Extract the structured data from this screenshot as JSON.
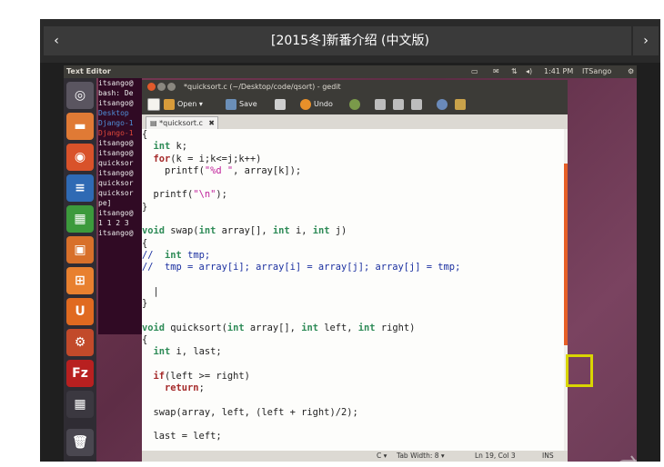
{
  "header": {
    "title": "[2015冬]新番介绍 (中文版)",
    "prev_label": "‹",
    "next_label": "›"
  },
  "ubuntu_panel": {
    "app_name": "Text Editor",
    "time": "1:41 PM",
    "user": "ITSango"
  },
  "terminal_lines": [
    "itsango@",
    "bash: De",
    "itsango@",
    "Desktop",
    "Django-1",
    "Django-1",
    "itsango@",
    "itsango@",
    "quicksor",
    "itsango@",
    "quicksor",
    "quicksor",
    "pe]",
    "itsango@",
    "1 1 2 3",
    "itsango@"
  ],
  "gedit": {
    "window_title": "*quicksort.c (~/Desktop/code/qsort) - gedit",
    "toolbar": {
      "open_label": "Open",
      "save_label": "Save",
      "undo_label": "Undo"
    },
    "tab_label": "*quicksort.c",
    "status": {
      "language": "C ▾",
      "tab_width": "Tab Width: 8 ▾",
      "position": "Ln 19, Col 3",
      "mode": "INS"
    }
  },
  "code_lines": [
    {
      "indent": "",
      "parts": [
        [
          "",
          "{"
        ]
      ]
    },
    {
      "indent": "  ",
      "parts": [
        [
          "ty",
          "int"
        ],
        [
          "",
          " k;"
        ]
      ]
    },
    {
      "indent": "  ",
      "parts": [
        [
          "kw",
          "for"
        ],
        [
          "",
          "(k = i;k<=j;k++)"
        ]
      ]
    },
    {
      "indent": "    ",
      "parts": [
        [
          "",
          "printf("
        ],
        [
          "st",
          "\"%d \""
        ],
        [
          "",
          ", array[k]);"
        ]
      ]
    },
    {
      "indent": "",
      "parts": [
        [
          "",
          ""
        ]
      ]
    },
    {
      "indent": "  ",
      "parts": [
        [
          "",
          "printf("
        ],
        [
          "st",
          "\"\\n\""
        ],
        [
          "",
          ");"
        ]
      ]
    },
    {
      "indent": "",
      "parts": [
        [
          "",
          "}"
        ]
      ]
    },
    {
      "indent": "",
      "parts": [
        [
          "",
          ""
        ]
      ]
    },
    {
      "indent": "",
      "parts": [
        [
          "ty",
          "void"
        ],
        [
          "",
          " swap("
        ],
        [
          "ty",
          "int"
        ],
        [
          "",
          " array[], "
        ],
        [
          "ty",
          "int"
        ],
        [
          "",
          " i, "
        ],
        [
          "ty",
          "int"
        ],
        [
          "",
          " j)"
        ]
      ]
    },
    {
      "indent": "",
      "parts": [
        [
          "",
          "{"
        ]
      ]
    },
    {
      "indent": "",
      "parts": [
        [
          "cm",
          "//  "
        ],
        [
          "ty",
          "int"
        ],
        [
          "cm",
          " tmp;"
        ]
      ]
    },
    {
      "indent": "",
      "parts": [
        [
          "cm",
          "//  tmp = array[i]; array[i] = array[j]; array[j] = tmp;"
        ]
      ]
    },
    {
      "indent": "",
      "parts": [
        [
          "",
          ""
        ]
      ]
    },
    {
      "indent": "  ",
      "parts": [
        [
          "",
          "|"
        ]
      ]
    },
    {
      "indent": "",
      "parts": [
        [
          "",
          "}"
        ]
      ]
    },
    {
      "indent": "",
      "parts": [
        [
          "",
          ""
        ]
      ]
    },
    {
      "indent": "",
      "parts": [
        [
          "ty",
          "void"
        ],
        [
          "",
          " quicksort("
        ],
        [
          "ty",
          "int"
        ],
        [
          "",
          " array[], "
        ],
        [
          "ty",
          "int"
        ],
        [
          "",
          " left, "
        ],
        [
          "ty",
          "int"
        ],
        [
          "",
          " right)"
        ]
      ]
    },
    {
      "indent": "",
      "parts": [
        [
          "",
          "{"
        ]
      ]
    },
    {
      "indent": "  ",
      "parts": [
        [
          "ty",
          "int"
        ],
        [
          "",
          " i, last;"
        ]
      ]
    },
    {
      "indent": "",
      "parts": [
        [
          "",
          ""
        ]
      ]
    },
    {
      "indent": "  ",
      "parts": [
        [
          "kw",
          "if"
        ],
        [
          "",
          "(left >= right)"
        ]
      ]
    },
    {
      "indent": "    ",
      "parts": [
        [
          "kw",
          "return"
        ],
        [
          "",
          ";"
        ]
      ]
    },
    {
      "indent": "",
      "parts": [
        [
          "",
          ""
        ]
      ]
    },
    {
      "indent": "  ",
      "parts": [
        [
          "",
          "swap(array, left, (left + right)/2);"
        ]
      ]
    },
    {
      "indent": "",
      "parts": [
        [
          "",
          ""
        ]
      ]
    },
    {
      "indent": "  ",
      "parts": [
        [
          "",
          "last = left;"
        ]
      ]
    }
  ],
  "colors": {
    "accent_orange": "#e65f27",
    "desktop_purple": "#5e2d46",
    "keyword_red": "#a52a2a",
    "type_green": "#2e8b57",
    "comment_blue": "#1a2fa0"
  },
  "icons": [
    "chevron-left-icon",
    "chevron-right-icon",
    "ubuntu-dash-icon",
    "files-icon",
    "firefox-icon",
    "writer-icon",
    "calc-icon",
    "impress-icon",
    "software-center-icon",
    "ubuntu-one-icon",
    "settings-icon",
    "filezilla-icon",
    "workspace-icon",
    "trash-icon",
    "play-icon"
  ]
}
